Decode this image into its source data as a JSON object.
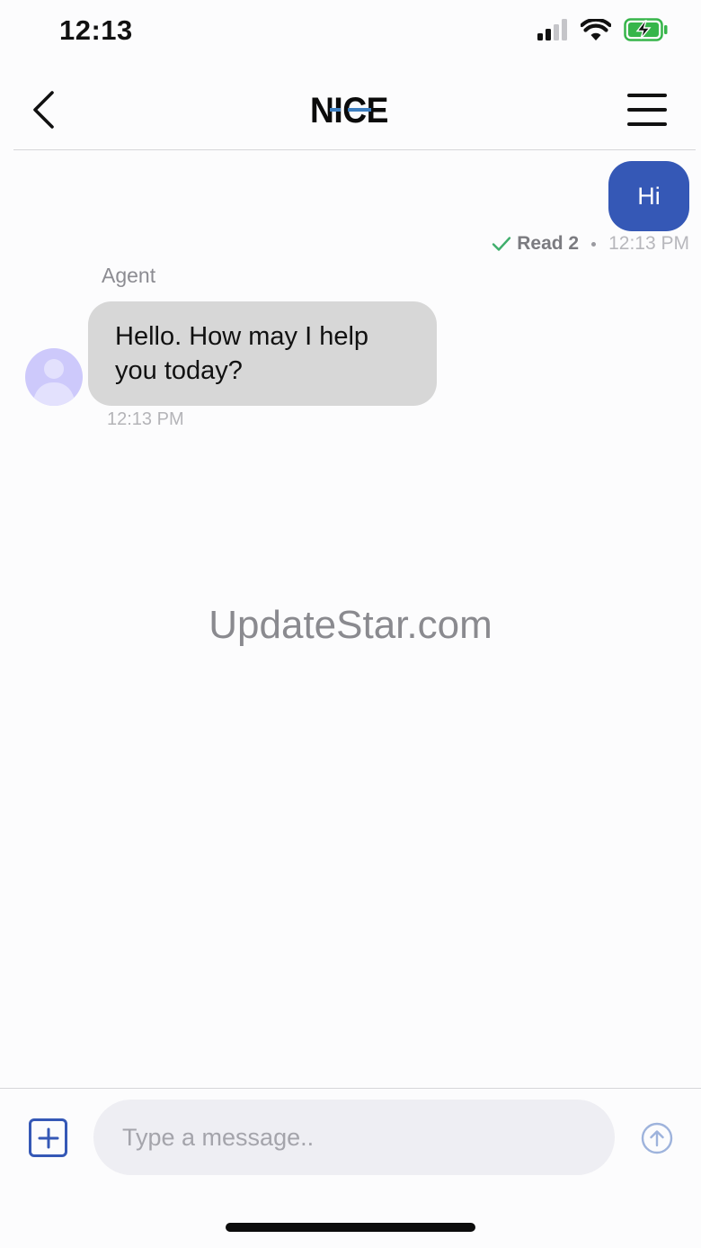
{
  "status_bar": {
    "time": "12:13",
    "signal_icon": "cellular-signal-icon",
    "wifi_icon": "wifi-icon",
    "battery_icon": "battery-charging-icon",
    "battery_color": "#36b54a"
  },
  "nav": {
    "back_icon": "chevron-left-icon",
    "logo_text": "NICE",
    "menu_icon": "hamburger-menu-icon"
  },
  "colors": {
    "outgoing_bubble": "#3558b6",
    "incoming_bubble": "#d7d7d7",
    "avatar_bg": "#cdc9fb",
    "read_check": "#3fae6c",
    "logo_accent": "#3d7fc1"
  },
  "messages": [
    {
      "direction": "outgoing",
      "text": "Hi",
      "status": "Read 2",
      "time": "12:13 PM"
    },
    {
      "direction": "incoming",
      "sender": "Agent",
      "text": "Hello.  How may I help you today?",
      "time": "12:13 PM",
      "avatar_icon": "person-avatar-icon"
    }
  ],
  "watermark": "UpdateStar.com",
  "composer": {
    "attach_icon": "plus-square-icon",
    "placeholder": "Type a message..",
    "value": "",
    "send_icon": "arrow-up-circle-icon"
  }
}
